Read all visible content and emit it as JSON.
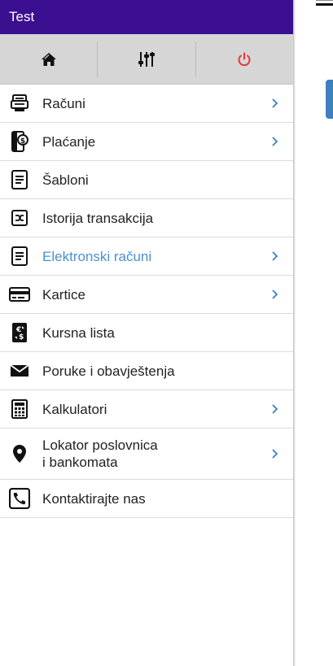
{
  "header": {
    "title": "Test"
  },
  "tabs": [
    {
      "icon": "home-icon"
    },
    {
      "icon": "sliders-icon"
    },
    {
      "icon": "power-icon"
    }
  ],
  "menu": {
    "items": [
      {
        "label": "Računi",
        "icon": "bill-icon",
        "has_chevron": true
      },
      {
        "label": "Plaćanje",
        "icon": "phone-payment-icon",
        "has_chevron": true
      },
      {
        "label": "Šabloni",
        "icon": "document-icon",
        "has_chevron": false
      },
      {
        "label": "Istorija transakcija",
        "icon": "history-icon",
        "has_chevron": false
      },
      {
        "label": "Elektronski računi",
        "icon": "document-icon",
        "has_chevron": true,
        "active": true
      },
      {
        "label": "Kartice",
        "icon": "card-icon",
        "has_chevron": true
      },
      {
        "label": "Kursna lista",
        "icon": "exchange-icon",
        "has_chevron": false
      },
      {
        "label": "Poruke i obavještenja",
        "icon": "envelope-icon",
        "has_chevron": false
      },
      {
        "label": "Kalkulatori",
        "icon": "calculator-icon",
        "has_chevron": true
      },
      {
        "label_line1": "Lokator poslovnica",
        "label_line2": "i bankomata",
        "icon": "location-pin-icon",
        "has_chevron": true
      },
      {
        "label": "Kontaktirajte nas",
        "icon": "phone-icon",
        "has_chevron": false
      }
    ]
  },
  "colors": {
    "header": "#3b0f8f",
    "active_text": "#4a8fcf",
    "power": "#e53935",
    "chevron": "#3d7fbf"
  }
}
